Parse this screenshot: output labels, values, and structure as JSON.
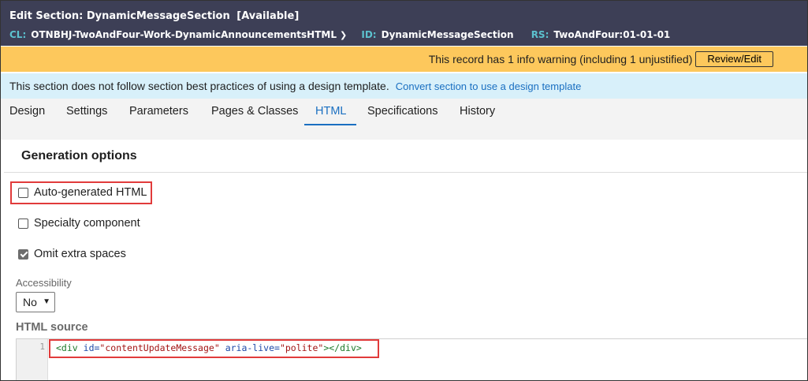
{
  "header": {
    "title_prefix": "Edit",
    "title": "Section: DynamicMessageSection",
    "status": "[Available]",
    "cl_key": "CL:",
    "cl_value": "OTNBHJ-TwoAndFour-Work-DynamicAnnouncementsHTML",
    "id_key": "ID:",
    "id_value": "DynamicMessageSection",
    "rs_key": "RS:",
    "rs_value": "TwoAndFour:01-01-01"
  },
  "warning": {
    "text": "This record has 1 info warning (including 1 unjustified)",
    "button_label": "Review/Edit"
  },
  "info": {
    "text": "This section does not follow section best practices of using a design template.",
    "link_label": "Convert section to use a design template"
  },
  "tabs": [
    {
      "label": "Design"
    },
    {
      "label": "Settings"
    },
    {
      "label": "Parameters"
    },
    {
      "label": "Pages & Classes"
    },
    {
      "label": "HTML"
    },
    {
      "label": "Specifications"
    },
    {
      "label": "History"
    }
  ],
  "active_tab": "HTML",
  "generation": {
    "title": "Generation options",
    "auto_generated": {
      "label": "Auto-generated HTML",
      "checked": false
    },
    "specialty": {
      "label": "Specialty component",
      "checked": false
    },
    "omit_spaces": {
      "label": "Omit extra spaces",
      "checked": true
    }
  },
  "accessibility": {
    "label": "Accessibility",
    "value": "No"
  },
  "html_source": {
    "label": "HTML source",
    "line_number": "1",
    "code": {
      "open": "<div",
      "attr1": "id=",
      "val1": "\"contentUpdateMessage\"",
      "attr2": "aria-live=",
      "val2": "\"polite\"",
      "close": "></div>"
    }
  },
  "colors": {
    "header_bg": "#3d3f56",
    "warning_bg": "#fdc85c",
    "info_bg": "#d8f0fa",
    "accent": "#1a6fc1",
    "highlight": "#e13b3b"
  }
}
